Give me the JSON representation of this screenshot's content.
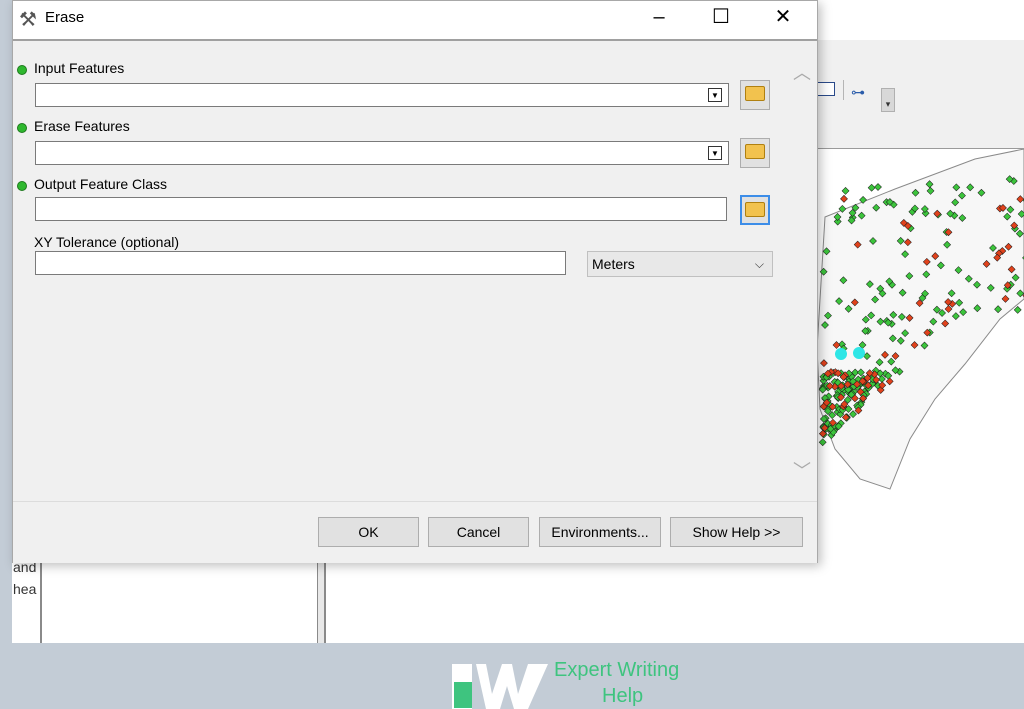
{
  "dialog": {
    "title": "Erase",
    "title_icon": "hammer-icon",
    "params": [
      {
        "label": "Input Features",
        "required": true,
        "value": "",
        "has_dropdown": true
      },
      {
        "label": "Erase Features",
        "required": true,
        "value": "",
        "has_dropdown": true
      },
      {
        "label": "Output Feature Class",
        "required": true,
        "value": "",
        "has_dropdown": false
      },
      {
        "label": "XY Tolerance (optional)",
        "required": false,
        "value": "",
        "has_dropdown": false
      }
    ],
    "units": {
      "selected": "Meters"
    },
    "buttons": {
      "ok": "OK",
      "cancel": "Cancel",
      "environments": "Environments...",
      "help": "Show Help >>"
    }
  },
  "background_app": {
    "side_text": [
      "and",
      "hea"
    ]
  },
  "watermark": {
    "line1": "Expert Writing",
    "line2": "Help"
  },
  "colors": {
    "accent": "#3c8de8",
    "required_dot": "#2fb82f",
    "logo_green": "#3ec47f",
    "map_point_green": "#3cc43c",
    "map_point_red": "#e0421c",
    "map_point_cyan": "#2ee6e6"
  }
}
